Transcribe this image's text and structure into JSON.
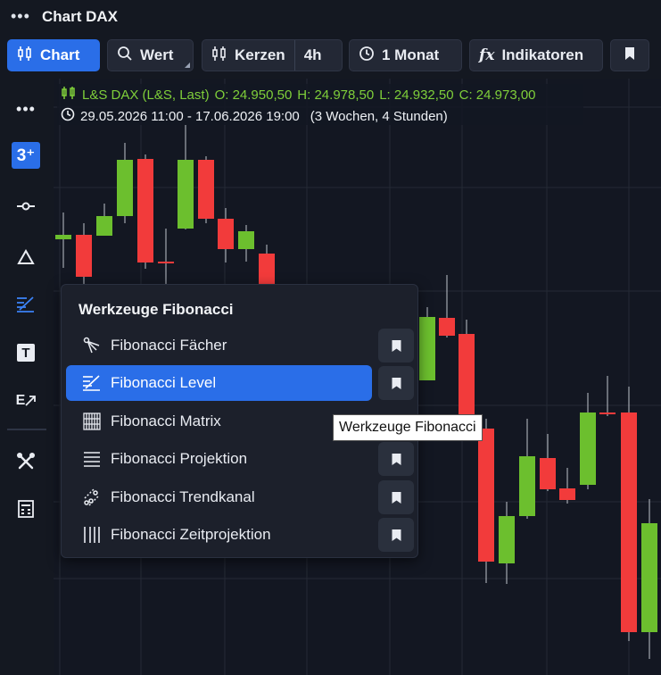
{
  "window": {
    "title": "Chart DAX"
  },
  "toolbar": {
    "chart_label": "Chart",
    "wert_label": "Wert",
    "kerzen_label": "Kerzen",
    "interval_label": "4h",
    "range_label": "1 Monat",
    "indikatoren_label": "Indikatoren"
  },
  "legend": {
    "instrument": "L&S DAX (L&S, Last)",
    "open": "O: 24.950,50",
    "high": "H: 24.978,50",
    "low": "L: 24.932,50",
    "close": "C: 24.973,00",
    "range": "29.05.2026 11:00 - 17.06.2026 19:00",
    "duration": "(3 Wochen, 4 Stunden)"
  },
  "sidebar": {
    "items": [
      {
        "icon": "more-icon"
      },
      {
        "icon": "elliott-wave-icon",
        "label": "3⁺"
      },
      {
        "icon": "line-tool-icon"
      },
      {
        "icon": "triangle-icon"
      },
      {
        "icon": "fibonacci-icon"
      },
      {
        "icon": "text-icon",
        "label": "T"
      },
      {
        "icon": "annotation-arrow-icon",
        "label": "E"
      },
      {
        "icon": "tools-icon"
      },
      {
        "icon": "calculator-icon"
      }
    ]
  },
  "fib_menu": {
    "title": "Werkzeuge Fibonacci",
    "items": [
      {
        "label": "Fibonacci Fächer",
        "icon": "fib-fan-icon"
      },
      {
        "label": "Fibonacci Level",
        "icon": "fib-level-icon",
        "active": true
      },
      {
        "label": "Fibonacci Matrix",
        "icon": "fib-matrix-icon"
      },
      {
        "label": "Fibonacci Projektion",
        "icon": "fib-projection-icon"
      },
      {
        "label": "Fibonacci Trendkanal",
        "icon": "fib-channel-icon"
      },
      {
        "label": "Fibonacci Zeitprojektion",
        "icon": "fib-time-icon"
      }
    ]
  },
  "tooltip": {
    "text": "Werkzeuge Fibonacci"
  },
  "colors": {
    "accent": "#2a6ee8",
    "up": "#6cbf2e",
    "down": "#f23b3b",
    "legend_green": "#7fcf3a"
  }
}
